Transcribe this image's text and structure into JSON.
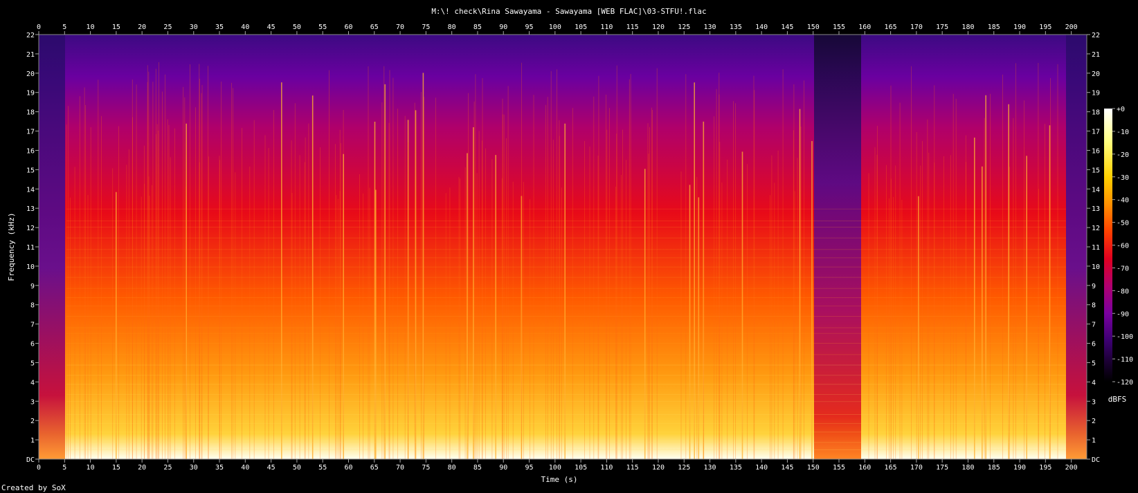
{
  "chart_data": {
    "type": "heatmap",
    "title": "M:\\! check\\Rina Sawayama - Sawayama [WEB FLAC]\\03-STFU!.flac",
    "xlabel": "Time (s)",
    "ylabel": "Frequency (kHz)",
    "xlim": [
      0,
      203
    ],
    "ylim": [
      0,
      22
    ],
    "x_ticks": [
      "0",
      "5",
      "10",
      "15",
      "20",
      "25",
      "30",
      "35",
      "40",
      "45",
      "50",
      "55",
      "60",
      "65",
      "70",
      "75",
      "80",
      "85",
      "90",
      "95",
      "100",
      "105",
      "110",
      "115",
      "120",
      "125",
      "130",
      "135",
      "140",
      "145",
      "150",
      "155",
      "160",
      "165",
      "170",
      "175",
      "180",
      "185",
      "190",
      "195",
      "200"
    ],
    "y_ticks": [
      "DC",
      "1",
      "2",
      "3",
      "4",
      "5",
      "6",
      "7",
      "8",
      "9",
      "10",
      "11",
      "12",
      "13",
      "14",
      "15",
      "16",
      "17",
      "18",
      "19",
      "20",
      "21",
      "22"
    ],
    "colorbar": {
      "label": "dBFS",
      "ticks": [
        "+0",
        "-10",
        "-20",
        "-30",
        "-40",
        "-50",
        "-60",
        "-70",
        "-80",
        "-90",
        "-100",
        "-110",
        "-120"
      ],
      "range": [
        -120,
        0
      ]
    },
    "colormap": [
      "#000000",
      "#1a0030",
      "#3c0072",
      "#7a00a0",
      "#b00070",
      "#e00020",
      "#ff4000",
      "#ff9000",
      "#ffd000",
      "#ffff80",
      "#ffffff"
    ],
    "footer": "Created by SoX"
  }
}
